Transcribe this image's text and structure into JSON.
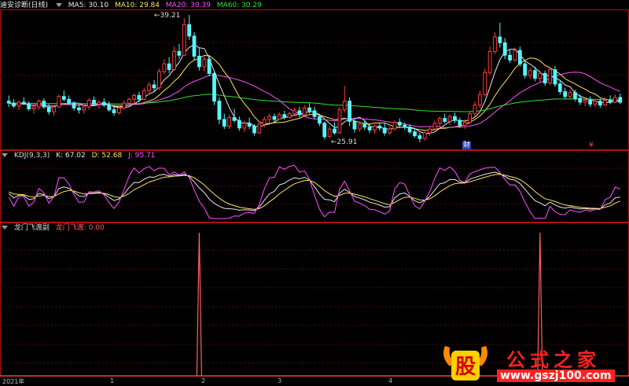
{
  "main_panel": {
    "title": "迪安诊断(日线)",
    "ma_labels": [
      {
        "text": "MA5: 30.10",
        "color": "#e8e8e8"
      },
      {
        "text": "MA10: 29.84",
        "color": "#ffe060"
      },
      {
        "text": "MA20: 30.39",
        "color": "#ff50ff"
      },
      {
        "text": "MA60: 30.29",
        "color": "#30e030"
      }
    ],
    "high_label": "39.21",
    "low_label": "25.91",
    "markers": [
      "财",
      "¥"
    ]
  },
  "kdj_panel": {
    "title": "KDJ(9,3,3)",
    "k_label": "K: 67.02",
    "d_label": "D: 52.68",
    "j_label": "J: 95.71"
  },
  "sub_panel": {
    "title": "龙门飞渡副",
    "value_label": "龙门飞渡: 0.00"
  },
  "x_axis": [
    "2021年",
    "1",
    "2",
    "3",
    "4"
  ],
  "watermark": {
    "logo_char": "股",
    "brand_text": "公式之家",
    "url": "www.gszj100.com"
  },
  "colors": {
    "up": "#ff3b3b",
    "down": "#54f7ff",
    "ma5": "#e8e8e8",
    "ma10": "#ffe060",
    "ma20": "#ff50ff",
    "ma60": "#30e030",
    "panel_border": "#b01010",
    "signal": "#ff6060"
  },
  "chart_data": {
    "type": "candlestick",
    "ohlc": [
      [
        30.2,
        30.8,
        29.6,
        30.0
      ],
      [
        30.0,
        30.4,
        29.5,
        29.7
      ],
      [
        29.7,
        30.3,
        29.3,
        30.1
      ],
      [
        30.1,
        30.6,
        29.8,
        29.9
      ],
      [
        29.9,
        30.2,
        29.2,
        29.4
      ],
      [
        29.4,
        29.9,
        28.9,
        29.6
      ],
      [
        29.6,
        30.4,
        29.3,
        30.2
      ],
      [
        30.2,
        30.5,
        29.4,
        29.6
      ],
      [
        29.6,
        29.9,
        28.8,
        29.1
      ],
      [
        29.1,
        29.8,
        28.7,
        29.6
      ],
      [
        29.6,
        30.9,
        29.5,
        30.7
      ],
      [
        30.7,
        31.3,
        30.2,
        30.4
      ],
      [
        30.4,
        30.8,
        29.8,
        30.0
      ],
      [
        30.0,
        30.2,
        29.2,
        29.5
      ],
      [
        29.5,
        29.9,
        28.9,
        29.3
      ],
      [
        29.3,
        29.8,
        28.9,
        29.6
      ],
      [
        29.6,
        30.5,
        29.3,
        30.3
      ],
      [
        30.3,
        30.7,
        29.7,
        29.9
      ],
      [
        29.9,
        30.3,
        29.4,
        30.1
      ],
      [
        30.1,
        30.5,
        29.6,
        29.8
      ],
      [
        29.8,
        30.2,
        29.1,
        29.3
      ],
      [
        29.3,
        29.6,
        28.7,
        29.0
      ],
      [
        29.0,
        29.7,
        28.8,
        29.5
      ],
      [
        29.5,
        30.3,
        29.3,
        30.0
      ],
      [
        30.0,
        30.6,
        29.8,
        30.4
      ],
      [
        30.4,
        31.0,
        30.0,
        30.8
      ],
      [
        30.8,
        31.2,
        30.1,
        30.4
      ],
      [
        30.4,
        31.6,
        30.3,
        31.3
      ],
      [
        31.3,
        32.2,
        30.9,
        31.9
      ],
      [
        31.9,
        32.4,
        31.2,
        31.6
      ],
      [
        31.6,
        33.6,
        31.4,
        33.3
      ],
      [
        33.3,
        34.6,
        33.0,
        34.1
      ],
      [
        34.1,
        34.8,
        33.1,
        33.5
      ],
      [
        33.5,
        35.9,
        33.4,
        35.4
      ],
      [
        35.4,
        36.2,
        34.6,
        35.0
      ],
      [
        35.0,
        38.9,
        34.9,
        38.2
      ],
      [
        38.2,
        39.21,
        36.6,
        37.0
      ],
      [
        37.0,
        37.4,
        34.5,
        34.9
      ],
      [
        34.9,
        35.8,
        33.4,
        33.8
      ],
      [
        33.8,
        34.9,
        33.3,
        34.6
      ],
      [
        34.6,
        35.0,
        32.8,
        33.1
      ],
      [
        33.1,
        33.4,
        29.8,
        30.2
      ],
      [
        30.2,
        30.6,
        27.8,
        28.3
      ],
      [
        28.3,
        28.9,
        27.3,
        27.6
      ],
      [
        27.6,
        28.8,
        27.3,
        28.5
      ],
      [
        28.5,
        29.4,
        28.0,
        28.2
      ],
      [
        28.2,
        28.6,
        27.1,
        27.4
      ],
      [
        27.4,
        28.2,
        27.0,
        27.9
      ],
      [
        27.9,
        28.5,
        27.3,
        27.6
      ],
      [
        27.6,
        27.8,
        26.6,
        26.9
      ],
      [
        26.9,
        28.1,
        26.8,
        27.8
      ],
      [
        27.8,
        28.6,
        27.5,
        28.3
      ],
      [
        28.3,
        28.9,
        27.9,
        28.6
      ],
      [
        28.6,
        28.9,
        28.0,
        28.3
      ],
      [
        28.3,
        29.0,
        28.2,
        28.8
      ],
      [
        28.8,
        29.2,
        28.3,
        28.5
      ],
      [
        28.5,
        29.1,
        28.4,
        28.9
      ],
      [
        28.9,
        29.5,
        28.6,
        29.2
      ],
      [
        29.2,
        29.6,
        28.5,
        28.8
      ],
      [
        28.8,
        29.8,
        28.7,
        29.5
      ],
      [
        29.5,
        30.0,
        28.9,
        29.2
      ],
      [
        29.2,
        29.6,
        28.3,
        28.6
      ],
      [
        28.6,
        28.9,
        27.6,
        27.9
      ],
      [
        27.9,
        28.1,
        26.2,
        26.5
      ],
      [
        26.5,
        27.6,
        26.4,
        27.3
      ],
      [
        27.3,
        28.0,
        26.7,
        26.9
      ],
      [
        26.9,
        29.6,
        26.8,
        29.3
      ],
      [
        29.3,
        31.8,
        29.0,
        30.2
      ],
      [
        30.2,
        30.6,
        27.6,
        28.1
      ],
      [
        28.1,
        28.5,
        26.9,
        27.3
      ],
      [
        27.3,
        28.1,
        27.0,
        27.8
      ],
      [
        27.8,
        28.2,
        27.2,
        27.5
      ],
      [
        27.5,
        27.9,
        26.9,
        27.2
      ],
      [
        27.2,
        27.8,
        26.8,
        27.6
      ],
      [
        27.6,
        28.0,
        27.1,
        27.4
      ],
      [
        27.4,
        27.9,
        26.6,
        26.9
      ],
      [
        26.9,
        27.6,
        26.7,
        27.3
      ],
      [
        27.3,
        28.2,
        27.1,
        28.0
      ],
      [
        28.0,
        28.4,
        27.5,
        27.7
      ],
      [
        27.7,
        28.0,
        27.2,
        27.5
      ],
      [
        27.5,
        27.8,
        26.8,
        27.0
      ],
      [
        27.0,
        27.4,
        26.4,
        26.6
      ],
      [
        26.6,
        26.9,
        25.91,
        26.3
      ],
      [
        26.3,
        27.1,
        26.1,
        26.9
      ],
      [
        26.9,
        27.6,
        26.6,
        27.3
      ],
      [
        27.3,
        28.2,
        27.1,
        27.9
      ],
      [
        27.9,
        28.6,
        27.6,
        28.4
      ],
      [
        28.4,
        28.9,
        27.9,
        28.1
      ],
      [
        28.1,
        28.8,
        27.7,
        28.6
      ],
      [
        28.6,
        29.0,
        27.9,
        28.2
      ],
      [
        28.2,
        28.5,
        27.4,
        27.7
      ],
      [
        27.7,
        28.3,
        27.3,
        28.0
      ],
      [
        28.0,
        29.1,
        27.8,
        28.9
      ],
      [
        28.9,
        30.2,
        28.6,
        29.8
      ],
      [
        29.8,
        31.3,
        29.5,
        30.9
      ],
      [
        30.9,
        33.6,
        30.7,
        33.2
      ],
      [
        33.2,
        35.9,
        32.9,
        35.4
      ],
      [
        35.4,
        37.4,
        35.1,
        36.9
      ],
      [
        36.9,
        38.4,
        35.8,
        36.3
      ],
      [
        36.3,
        36.8,
        34.6,
        35.0
      ],
      [
        35.0,
        35.6,
        34.2,
        34.5
      ],
      [
        34.5,
        35.8,
        34.3,
        35.5
      ],
      [
        35.5,
        35.9,
        33.8,
        34.1
      ],
      [
        34.1,
        34.4,
        32.6,
        32.9
      ],
      [
        32.9,
        33.7,
        32.5,
        33.4
      ],
      [
        33.4,
        33.8,
        32.3,
        32.6
      ],
      [
        32.6,
        33.4,
        32.2,
        33.1
      ],
      [
        33.1,
        33.4,
        31.8,
        32.1
      ],
      [
        32.1,
        33.8,
        31.9,
        33.5
      ],
      [
        33.5,
        33.9,
        31.7,
        32.0
      ],
      [
        32.0,
        32.4,
        30.9,
        31.2
      ],
      [
        31.2,
        31.6,
        30.4,
        30.7
      ],
      [
        30.7,
        31.4,
        30.5,
        31.1
      ],
      [
        31.1,
        31.4,
        30.2,
        30.5
      ],
      [
        30.5,
        30.9,
        29.8,
        30.1
      ],
      [
        30.1,
        30.6,
        29.7,
        30.3
      ],
      [
        30.3,
        30.7,
        29.6,
        29.9
      ],
      [
        29.9,
        30.4,
        29.6,
        30.2
      ],
      [
        30.2,
        30.5,
        29.5,
        29.8
      ],
      [
        29.8,
        30.6,
        29.7,
        30.3
      ],
      [
        30.3,
        30.8,
        29.9,
        30.1
      ],
      [
        30.1,
        30.9,
        30.0,
        30.6
      ],
      [
        30.6,
        31.0,
        29.9,
        30.1
      ]
    ],
    "signal_spikes": [
      {
        "bar": 38,
        "value": 1
      },
      {
        "bar": 106,
        "value": 1
      }
    ],
    "x_labels": [
      "2021年",
      "1",
      "2",
      "3",
      "4"
    ]
  }
}
